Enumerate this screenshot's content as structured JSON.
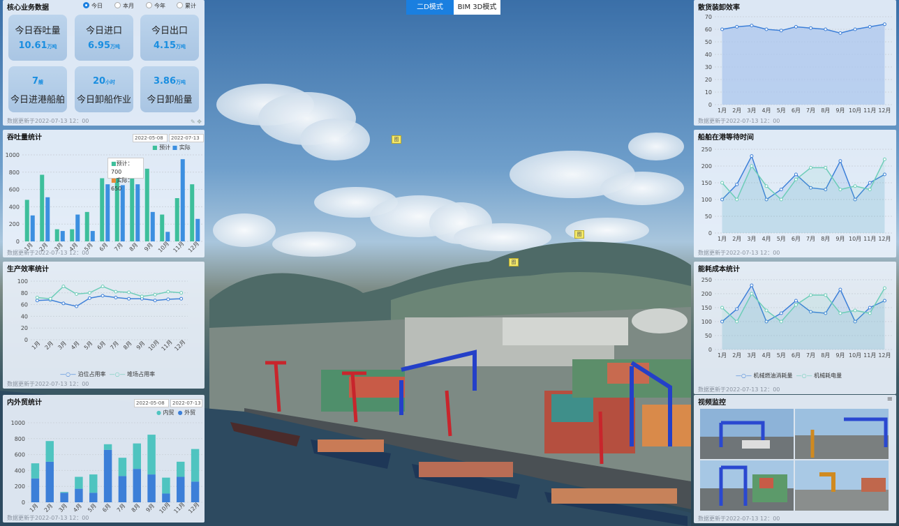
{
  "modes": {
    "two_d": "二D模式",
    "bim": "BIM 3D模式"
  },
  "core": {
    "title": "核心业务数据",
    "radios": [
      "今日",
      "本月",
      "今年",
      "累计"
    ],
    "tiles": [
      {
        "label": "今日吞吐量",
        "value": "10.61",
        "unit": "万吨"
      },
      {
        "label": "今日进口",
        "value": "6.95",
        "unit": "万吨"
      },
      {
        "label": "今日出口",
        "value": "4.15",
        "unit": "万吨"
      },
      {
        "label": "今日进港船舶",
        "value": "7",
        "unit": "艘"
      },
      {
        "label": "今日卸船作业",
        "value": "20",
        "unit": "小时"
      },
      {
        "label": "今日卸船量",
        "value": "3.86",
        "unit": "万吨"
      }
    ]
  },
  "update_text": "数据更新于2022-07-13  12：00",
  "chart_data": [
    {
      "id": "throughput",
      "type": "bar",
      "title": "吞吐量统计",
      "date_from": "2022-05-08",
      "date_to": "2022-07-13",
      "categories": [
        "1月",
        "2月",
        "3月",
        "4月",
        "5月",
        "6月",
        "7月",
        "8月",
        "9月",
        "10月",
        "11月",
        "12月"
      ],
      "series": [
        {
          "name": "预计",
          "values": [
            480,
            770,
            140,
            140,
            340,
            730,
            840,
            740,
            840,
            310,
            500,
            660
          ]
        },
        {
          "name": "实际",
          "values": [
            300,
            510,
            120,
            310,
            120,
            660,
            650,
            660,
            340,
            110,
            950,
            260
          ]
        }
      ],
      "ylim": [
        0,
        1000
      ],
      "yticks": [
        0,
        200,
        400,
        600,
        800,
        1000
      ],
      "tooltip": {
        "label1": "预计",
        "v1": "700",
        "label2": "实际",
        "v2": "650"
      },
      "colors": [
        "#3dbf9b",
        "#3c8fe0"
      ]
    },
    {
      "id": "efficiency",
      "type": "line",
      "title": "生产效率统计",
      "categories": [
        "1月",
        "2月",
        "3月",
        "4月",
        "5月",
        "6月",
        "7月",
        "8月",
        "9月",
        "10月",
        "11月",
        "12月"
      ],
      "series": [
        {
          "name": "泊位占用率",
          "values": [
            67,
            68,
            62,
            57,
            71,
            75,
            72,
            70,
            70,
            67,
            69,
            70
          ]
        },
        {
          "name": "堆场占用率",
          "values": [
            72,
            70,
            91,
            78,
            80,
            91,
            82,
            81,
            74,
            77,
            82,
            80
          ]
        }
      ],
      "ylim": [
        0,
        100
      ],
      "yticks": [
        0,
        20,
        40,
        60,
        80,
        100
      ],
      "colors": [
        "#3c7fd8",
        "#6dcdb8"
      ]
    },
    {
      "id": "trade",
      "type": "bar",
      "title": "内外贸统计",
      "stacked": true,
      "date_from": "2022-05-08",
      "date_to": "2022-07-13",
      "categories": [
        "1月",
        "2月",
        "3月",
        "4月",
        "5月",
        "6月",
        "7月",
        "8月",
        "9月",
        "10月",
        "11月",
        "12月"
      ],
      "series": [
        {
          "name": "外贸",
          "values": [
            300,
            510,
            120,
            170,
            120,
            660,
            330,
            420,
            350,
            110,
            320,
            260
          ]
        },
        {
          "name": "内贸",
          "values": [
            190,
            260,
            10,
            150,
            230,
            70,
            230,
            320,
            500,
            200,
            190,
            410
          ]
        }
      ],
      "legend": [
        "内贸",
        "外贸"
      ],
      "ylim": [
        0,
        1000
      ],
      "yticks": [
        0,
        200,
        400,
        600,
        800,
        1000
      ],
      "colors": [
        "#3c7fd8",
        "#4fc4c0"
      ]
    },
    {
      "id": "unload",
      "type": "area",
      "title": "散货装卸效率",
      "categories": [
        "1月",
        "2月",
        "3月",
        "4月",
        "5月",
        "6月",
        "7月",
        "8月",
        "9月",
        "10月",
        "11月",
        "12月"
      ],
      "series": [
        {
          "name": "",
          "values": [
            60,
            62,
            63,
            60,
            59,
            62,
            61,
            60,
            57,
            60,
            62,
            64
          ]
        }
      ],
      "ylim": [
        0,
        70
      ],
      "yticks": [
        0,
        10,
        20,
        30,
        40,
        50,
        60,
        70
      ],
      "colors": [
        "#3c7fd8"
      ]
    },
    {
      "id": "waiting",
      "type": "line",
      "title": "船舶在港等待时间",
      "categories": [
        "1月",
        "2月",
        "3月",
        "4月",
        "5月",
        "6月",
        "7月",
        "8月",
        "9月",
        "10月",
        "11月",
        "12月"
      ],
      "series": [
        {
          "name": "",
          "values": [
            100,
            145,
            230,
            100,
            130,
            175,
            135,
            130,
            215,
            100,
            150,
            175
          ]
        },
        {
          "name": "",
          "values": [
            150,
            100,
            200,
            140,
            100,
            160,
            195,
            195,
            130,
            140,
            130,
            220
          ]
        }
      ],
      "ylim": [
        0,
        250
      ],
      "yticks": [
        0,
        50,
        100,
        150,
        200,
        250
      ],
      "colors": [
        "#3c7fd8",
        "#6dcdb8"
      ]
    },
    {
      "id": "energy",
      "type": "line",
      "title": "能耗成本统计",
      "categories": [
        "1月",
        "2月",
        "3月",
        "4月",
        "5月",
        "6月",
        "7月",
        "8月",
        "9月",
        "10月",
        "11月",
        "12月"
      ],
      "series": [
        {
          "name": "机械燃油消耗量",
          "values": [
            100,
            145,
            230,
            100,
            130,
            175,
            135,
            130,
            215,
            100,
            150,
            175
          ]
        },
        {
          "name": "机械耗电量",
          "values": [
            150,
            100,
            200,
            140,
            100,
            160,
            195,
            195,
            130,
            140,
            130,
            220
          ]
        }
      ],
      "ylim": [
        0,
        250
      ],
      "yticks": [
        0,
        50,
        100,
        150,
        200,
        250
      ],
      "colors": [
        "#3c7fd8",
        "#6dcdb8"
      ]
    }
  ],
  "video": {
    "title": "视频监控",
    "menu_icon": "list-icon"
  },
  "labels": [
    "图",
    "图",
    "图"
  ]
}
